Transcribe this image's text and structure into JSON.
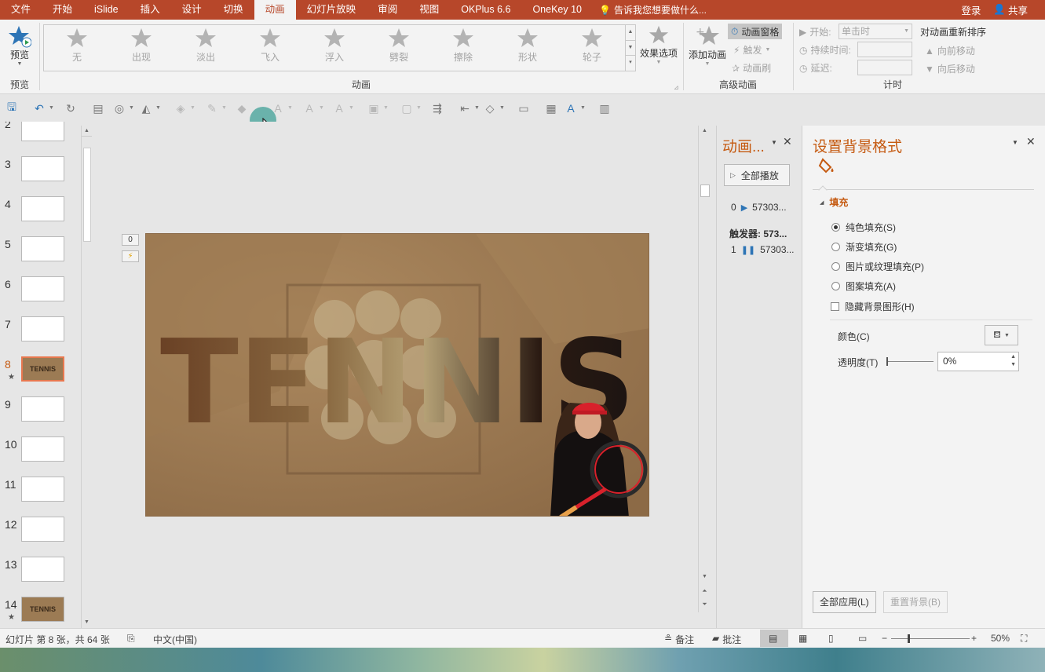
{
  "tabs": [
    "文件",
    "开始",
    "iSlide",
    "插入",
    "设计",
    "切换",
    "动画",
    "幻灯片放映",
    "审阅",
    "视图",
    "OKPlus 6.6",
    "OneKey 10"
  ],
  "active_tab_index": 6,
  "tell_me": "告诉我您想要做什么...",
  "login": "登录",
  "share": "共享",
  "ribbon": {
    "preview": {
      "label": "预览",
      "group": "预览"
    },
    "animation_group": "动画",
    "gallery": [
      "无",
      "出现",
      "淡出",
      "飞入",
      "浮入",
      "劈裂",
      "擦除",
      "形状",
      "轮子"
    ],
    "effect_options": "效果选项",
    "add_animation": "添加动画",
    "animation_pane": "动画窗格",
    "trigger": "触发",
    "painter": "动画刷",
    "advanced_group": "高级动画",
    "start_label": "开始:",
    "start_value": "单击时",
    "duration_label": "持续时间:",
    "delay_label": "延迟:",
    "timing_group": "计时",
    "reorder": "对动画重新排序",
    "move_earlier": "向前移动",
    "move_later": "向后移动"
  },
  "thumbnails": [
    {
      "num": "2",
      "selected": false,
      "img": false,
      "star": false
    },
    {
      "num": "3",
      "selected": false,
      "img": false,
      "star": false
    },
    {
      "num": "4",
      "selected": false,
      "img": false,
      "star": false
    },
    {
      "num": "5",
      "selected": false,
      "img": false,
      "star": false
    },
    {
      "num": "6",
      "selected": false,
      "img": false,
      "star": false
    },
    {
      "num": "7",
      "selected": false,
      "img": false,
      "star": false
    },
    {
      "num": "8",
      "selected": true,
      "img": true,
      "star": true
    },
    {
      "num": "9",
      "selected": false,
      "img": false,
      "star": false
    },
    {
      "num": "10",
      "selected": false,
      "img": false,
      "star": false
    },
    {
      "num": "11",
      "selected": false,
      "img": false,
      "star": false
    },
    {
      "num": "12",
      "selected": false,
      "img": false,
      "star": false
    },
    {
      "num": "13",
      "selected": false,
      "img": false,
      "star": false
    },
    {
      "num": "14",
      "selected": false,
      "img": true,
      "star": true
    }
  ],
  "thumb_text": "TENNIS",
  "slide": {
    "text": "TENNIS",
    "tag_index": "0"
  },
  "anim_pane": {
    "title": "动画...",
    "play_all": "全部播放",
    "item_0_index": "0",
    "item_0_label": "57303...",
    "trigger_label": "触发器: 573...",
    "item_1_index": "1",
    "item_1_label": "57303..."
  },
  "format_pane": {
    "title": "设置背景格式",
    "fill_section": "填充",
    "options": [
      "纯色填充(S)",
      "渐变填充(G)",
      "图片或纹理填充(P)",
      "图案填充(A)"
    ],
    "selected_option": 0,
    "hide_bg": "隐藏背景图形(H)",
    "color_label": "颜色(C)",
    "transparency_label": "透明度(T)",
    "transparency_value": "0%",
    "apply_all": "全部应用(L)",
    "reset_bg": "重置背景(B)"
  },
  "status": {
    "slide_info": "幻灯片 第 8 张，共 64 张",
    "language": "中文(中国)",
    "notes": "备注",
    "comments": "批注",
    "zoom": "50%"
  },
  "colors": {
    "accent": "#b7472a",
    "pane_title": "#c55a11"
  }
}
